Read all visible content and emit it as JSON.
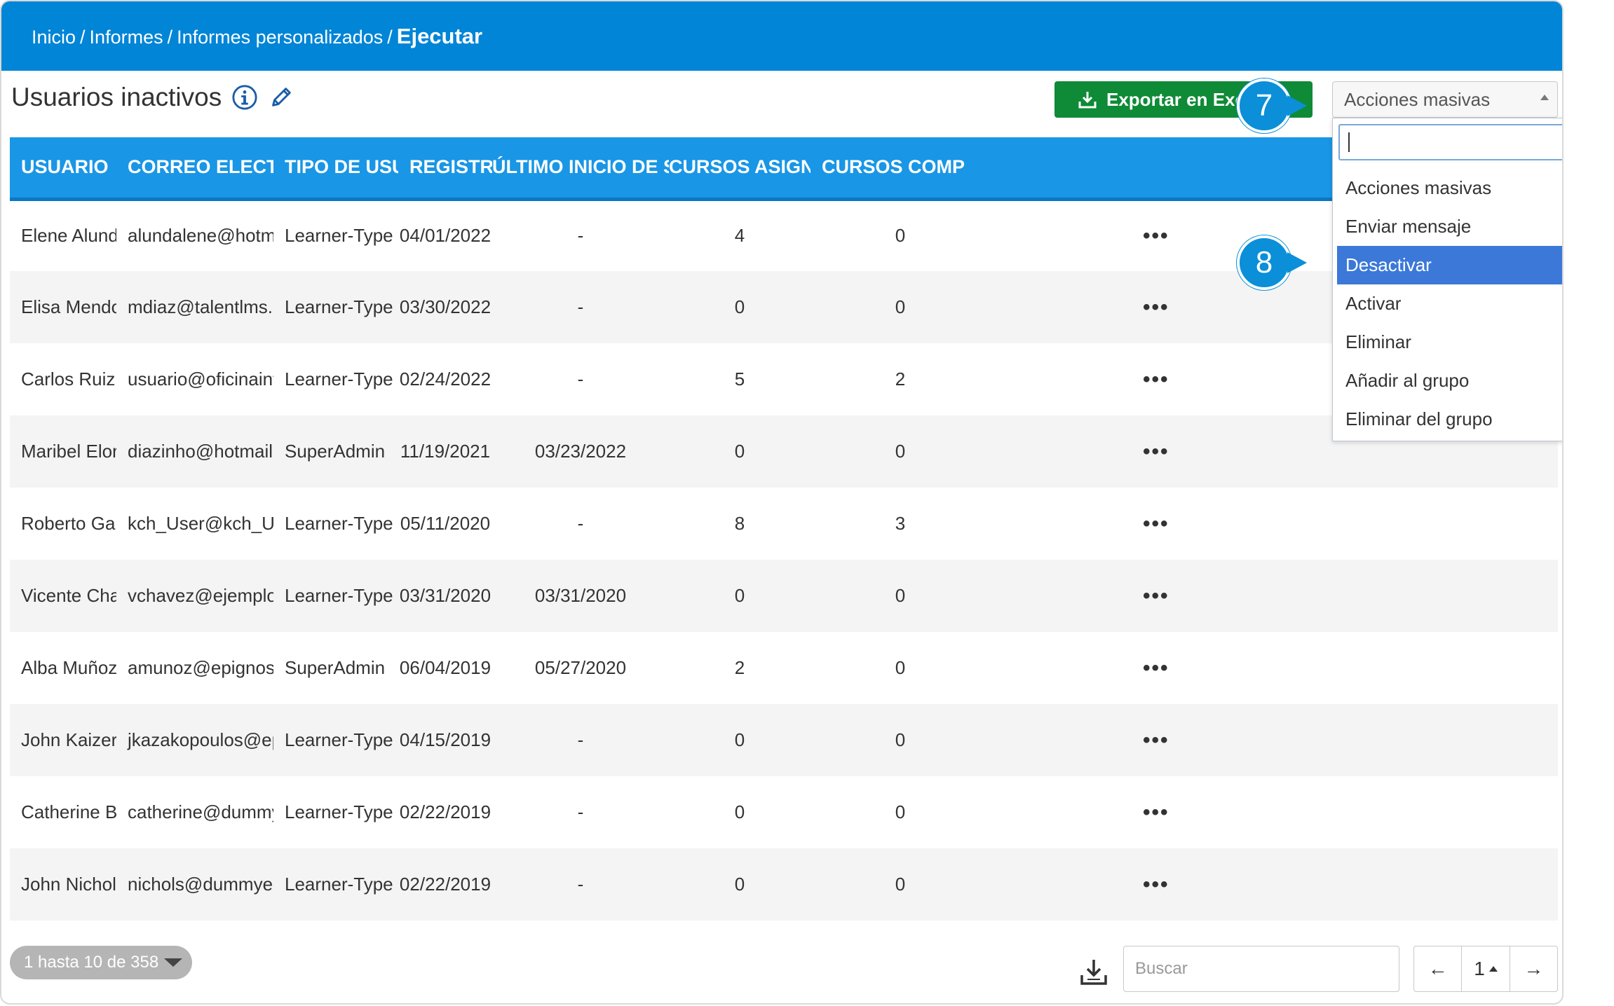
{
  "breadcrumb": {
    "items": [
      "Inicio",
      "Informes",
      "Informes personalizados"
    ],
    "separator": "/",
    "current": "Ejecutar"
  },
  "page": {
    "title": "Usuarios inactivos",
    "icons": [
      "info-icon",
      "pencil-icon"
    ]
  },
  "toolbar": {
    "export_label": "Exportar en Excel",
    "mass_actions_label": "Acciones masivas"
  },
  "table": {
    "columns": [
      "USUARIO",
      "CORREO ELECTRÓNICO",
      "TIPO DE USUARIO",
      "REGISTRO",
      "ÚLTIMO INICIO DE SESIÓN",
      "CURSOS ASIGNADOS",
      "CURSOS COMP"
    ],
    "rows": [
      {
        "user": "Elene Alunda",
        "email": "alundalene@hotmail...",
        "type": "Learner-Type",
        "registered": "04/01/2022",
        "last_login": "-",
        "assigned": "4",
        "completed": "0",
        "more": "•••"
      },
      {
        "user": "Elisa Mendoza",
        "email": "mdiaz@talentlms.co...",
        "type": "Learner-Type",
        "registered": "03/30/2022",
        "last_login": "-",
        "assigned": "0",
        "completed": "0",
        "more": "•••"
      },
      {
        "user": "Carlos Ruiz",
        "email": "usuario@oficinaint...",
        "type": "Learner-Type",
        "registered": "02/24/2022",
        "last_login": "-",
        "assigned": "5",
        "completed": "2",
        "more": "•••"
      },
      {
        "user": "Maribel Elorza",
        "email": "diazinho@hotmail.c...",
        "type": "SuperAdmin",
        "registered": "11/19/2021",
        "last_login": "03/23/2022",
        "assigned": "0",
        "completed": "0",
        "more": "•••"
      },
      {
        "user": "Roberto Garcia",
        "email": "kch_User@kch_User....",
        "type": "Learner-Type",
        "registered": "05/11/2020",
        "last_login": "-",
        "assigned": "8",
        "completed": "3",
        "more": "•••"
      },
      {
        "user": "Vicente Chavez",
        "email": "vchavez@ejemplo.es",
        "type": "Learner-Type",
        "registered": "03/31/2020",
        "last_login": "03/31/2020",
        "assigned": "0",
        "completed": "0",
        "more": "•••"
      },
      {
        "user": "Alba Muñoz",
        "email": "amunoz@epignosishq...",
        "type": "SuperAdmin",
        "registered": "06/04/2019",
        "last_login": "05/27/2020",
        "assigned": "2",
        "completed": "0",
        "more": "•••"
      },
      {
        "user": "John Kaizer",
        "email": "jkazakopoulos@epig...",
        "type": "Learner-Type",
        "registered": "04/15/2019",
        "last_login": "-",
        "assigned": "0",
        "completed": "0",
        "more": "•••"
      },
      {
        "user": "Catherine Blaine",
        "email": "catherine@dummyema...",
        "type": "Learner-Type",
        "registered": "02/22/2019",
        "last_login": "-",
        "assigned": "0",
        "completed": "0",
        "more": "•••"
      },
      {
        "user": "John Nichols",
        "email": "nichols@dummyemail...",
        "type": "Learner-Type",
        "registered": "02/22/2019",
        "last_login": "-",
        "assigned": "0",
        "completed": "0",
        "more": "•••"
      }
    ]
  },
  "dropdown": {
    "search_value": "",
    "options": [
      "Acciones masivas",
      "Enviar mensaje",
      "Desactivar",
      "Activar",
      "Eliminar",
      "Añadir al grupo",
      "Eliminar del grupo"
    ],
    "selected": "Desactivar"
  },
  "markers": {
    "step7": "7",
    "step8": "8"
  },
  "footer": {
    "count_label": "1 hasta 10 de 358",
    "search_placeholder": "Buscar",
    "prev": "←",
    "page": "1",
    "next": "→"
  },
  "colors": {
    "header_blue": "#0085d7",
    "table_header_blue": "#1996e6",
    "export_green": "#0f8a36",
    "selected_option": "#3b78d8"
  }
}
